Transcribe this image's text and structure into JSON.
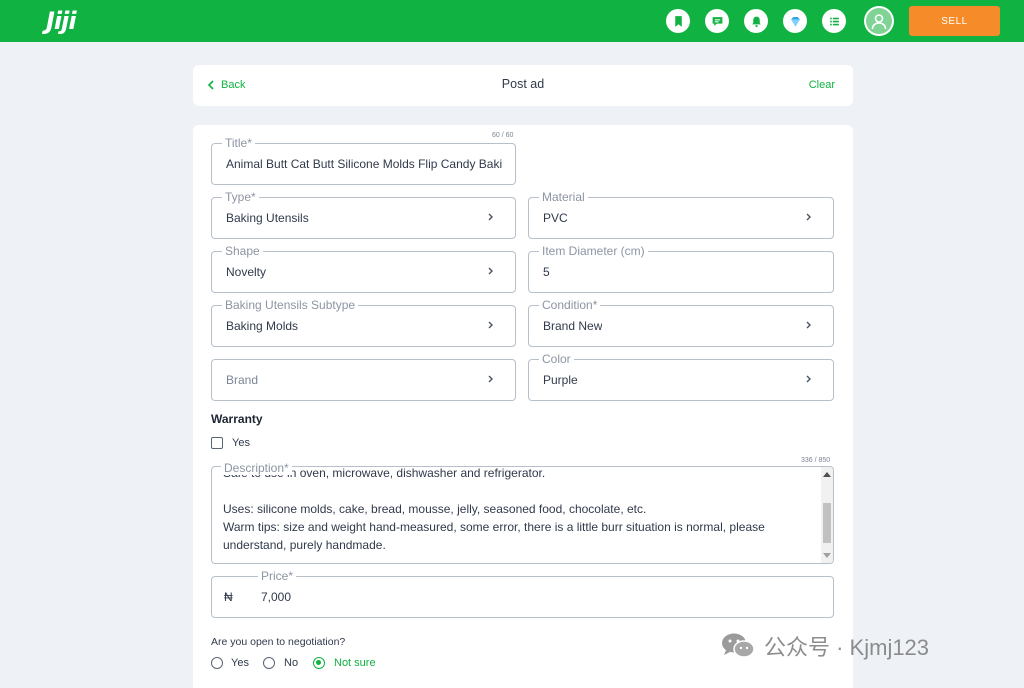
{
  "header": {
    "logo": "Jiji",
    "icons": [
      "bookmark-icon",
      "messages-icon",
      "notifications-icon",
      "premium-icon",
      "my-adverts-icon"
    ],
    "sell_label": "SELL"
  },
  "topbar": {
    "back_label": "Back",
    "title": "Post ad",
    "clear_label": "Clear"
  },
  "form": {
    "title": {
      "label": "Title*",
      "value": "Animal Butt Cat Butt Silicone Molds Flip Candy Baki",
      "counter": "60 / 60"
    },
    "type": {
      "label": "Type*",
      "value": "Baking Utensils"
    },
    "material": {
      "label": "Material",
      "value": "PVC"
    },
    "shape": {
      "label": "Shape",
      "value": "Novelty"
    },
    "diameter": {
      "label": "Item Diameter (cm)",
      "value": "5"
    },
    "subtype": {
      "label": "Baking Utensils Subtype",
      "value": "Baking Molds"
    },
    "condition": {
      "label": "Condition*",
      "value": "Brand New"
    },
    "brand": {
      "placeholder": "Brand"
    },
    "color": {
      "label": "Color",
      "value": "Purple"
    },
    "warranty": {
      "heading": "Warranty",
      "option": "Yes"
    },
    "description": {
      "label": "Description*",
      "counter": "336 / 850",
      "lines": [
        "Safe to use in oven, microwave, dishwasher and refrigerator.",
        "",
        "Uses: silicone molds, cake, bread, mousse, jelly, seasoned food, chocolate, etc.",
        "Warm tips: size and weight hand-measured, some error, there is a little burr situation is normal, please understand, purely handmade."
      ]
    },
    "price": {
      "label": "Price*",
      "currency": "₦",
      "value": "7,000"
    },
    "negotiation": {
      "question": "Are you open to negotiation?",
      "options": [
        "Yes",
        "No",
        "Not sure"
      ],
      "selected": "Not sure"
    }
  },
  "watermark": {
    "text": "公众号 · Kjmj123"
  },
  "colors": {
    "brand_green": "#10b242",
    "sell_orange": "#f68b29",
    "page_bg": "#eef2f7"
  }
}
